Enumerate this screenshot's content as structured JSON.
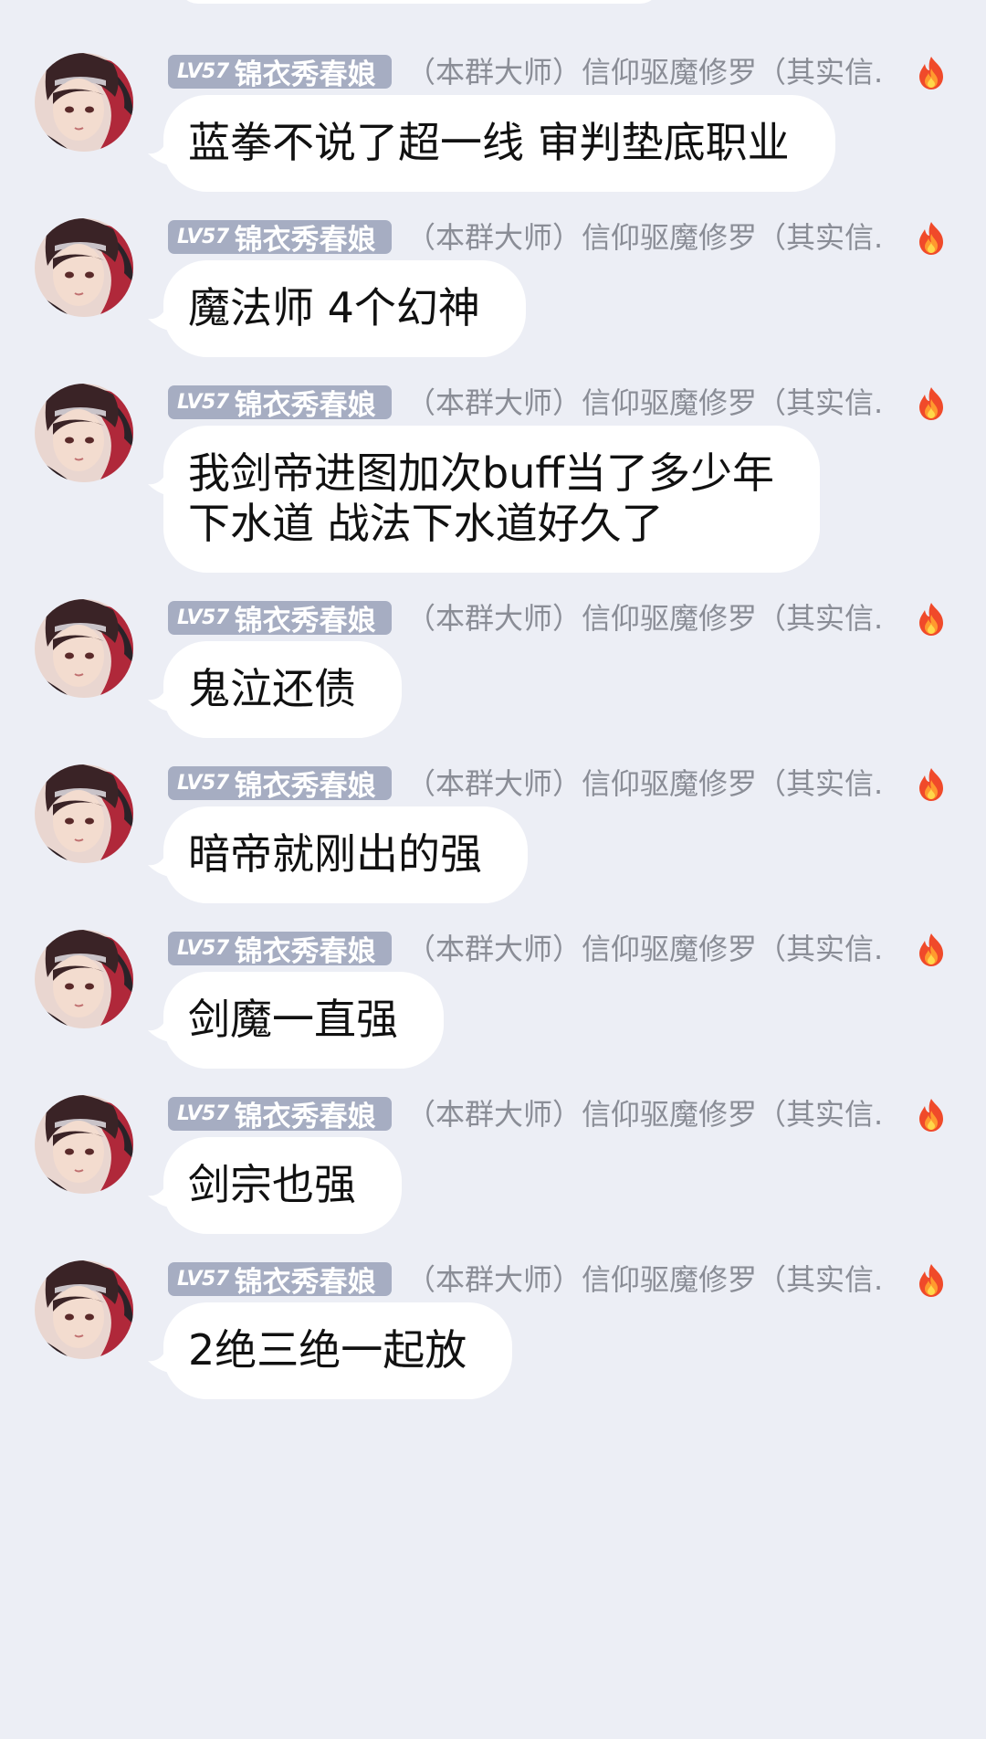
{
  "sender": {
    "level": "LV57",
    "nickname": "锦衣秀春娘",
    "title": "（本群大师）信仰驱魔修罗（其实信...",
    "avatar_icon": "anime-avatar",
    "badge_icon": "fire-icon",
    "badge_color": "#a6adc2"
  },
  "colors": {
    "background": "#eceef5",
    "bubble": "#ffffff",
    "title_text": "#8a8d96"
  },
  "messages": [
    {
      "text": "蓝拳不说了超一线 审判垫底职业"
    },
    {
      "text": "魔法师 4个幻神"
    },
    {
      "text": "我剑帝进图加次buff当了多少年\n下水道  战法下水道好久了"
    },
    {
      "text": "鬼泣还债"
    },
    {
      "text": "暗帝就刚出的强"
    },
    {
      "text": "剑魔一直强"
    },
    {
      "text": "剑宗也强"
    },
    {
      "text": "2绝三绝一起放"
    }
  ]
}
